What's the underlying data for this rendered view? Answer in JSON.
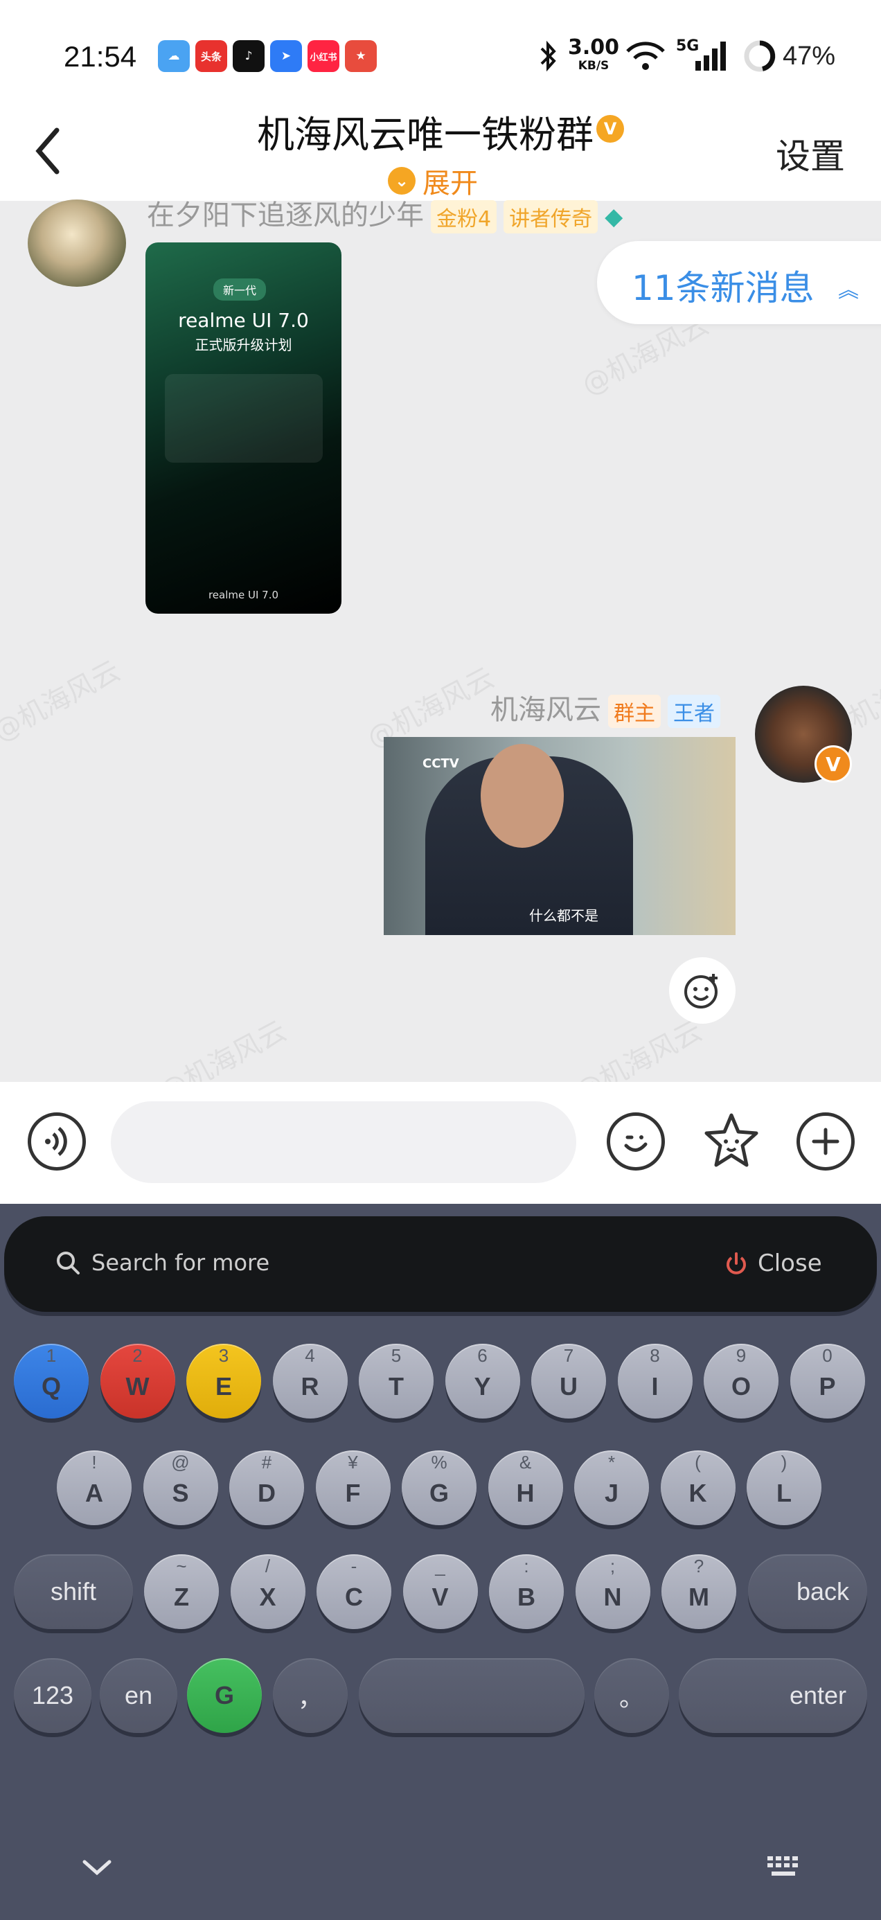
{
  "status_bar": {
    "time": "21:54",
    "net_speed": "3.00",
    "net_unit": "KB/S",
    "signal": "5G",
    "battery": "47%",
    "app_icons": [
      "weather",
      "头条",
      "tiktok",
      "feishu",
      "小红书",
      "game"
    ]
  },
  "header": {
    "title": "机海风云唯一铁粉群",
    "expand_label": "展开",
    "settings_label": "设置"
  },
  "messages": [
    {
      "sender": "在夕阳下追逐风的少年",
      "badges": [
        "金粉4",
        "讲者传奇"
      ],
      "image": {
        "pill": "新一代",
        "title": "realme UI 7.0",
        "subtitle": "正式版升级计划",
        "footer": "realme UI 7.0"
      }
    },
    {
      "sender": "机海风云",
      "badges": [
        "群主",
        "王者"
      ],
      "image": {
        "logo": "CCTV",
        "subtitle": "什么都不是"
      }
    }
  ],
  "new_messages": "11条新消息",
  "watermark": "@机海风云",
  "keyboard": {
    "search_placeholder": "Search for more",
    "close_label": "Close",
    "row1": [
      {
        "sup": "1",
        "key": "Q"
      },
      {
        "sup": "2",
        "key": "W"
      },
      {
        "sup": "3",
        "key": "E"
      },
      {
        "sup": "4",
        "key": "R"
      },
      {
        "sup": "5",
        "key": "T"
      },
      {
        "sup": "6",
        "key": "Y"
      },
      {
        "sup": "7",
        "key": "U"
      },
      {
        "sup": "8",
        "key": "I"
      },
      {
        "sup": "9",
        "key": "O"
      },
      {
        "sup": "0",
        "key": "P"
      }
    ],
    "row2": [
      {
        "sup": "!",
        "key": "A"
      },
      {
        "sup": "@",
        "key": "S"
      },
      {
        "sup": "#",
        "key": "D"
      },
      {
        "sup": "¥",
        "key": "F"
      },
      {
        "sup": "%",
        "key": "G"
      },
      {
        "sup": "&",
        "key": "H"
      },
      {
        "sup": "*",
        "key": "J"
      },
      {
        "sup": "(",
        "key": "K"
      },
      {
        "sup": ")",
        "key": "L"
      }
    ],
    "row3": [
      {
        "sup": "~",
        "key": "Z"
      },
      {
        "sup": "/",
        "key": "X"
      },
      {
        "sup": "-",
        "key": "C"
      },
      {
        "sup": "_",
        "key": "V"
      },
      {
        "sup": ":",
        "key": "B"
      },
      {
        "sup": ";",
        "key": "N"
      },
      {
        "sup": "?",
        "key": "M"
      }
    ],
    "shift": "shift",
    "back": "back",
    "num": "123",
    "lang": "en",
    "g": "G",
    "comma": "，",
    "period": "。",
    "enter": "enter"
  }
}
